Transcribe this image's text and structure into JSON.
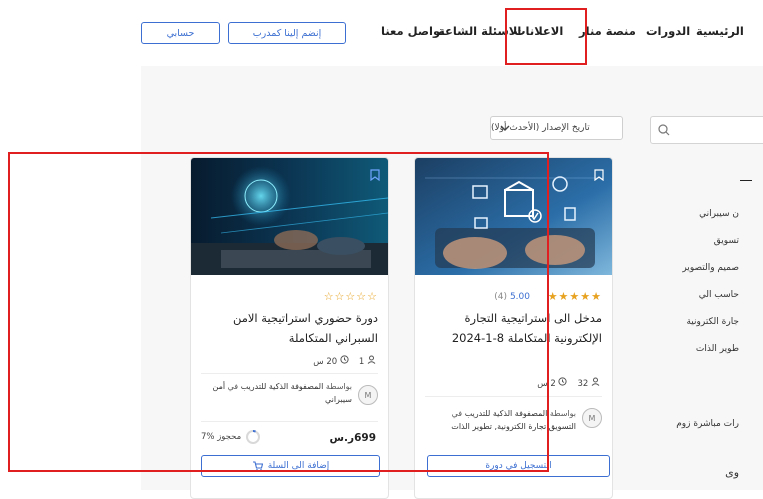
{
  "nav": {
    "items": [
      "الرئيسية",
      "الدورات",
      "منصة منار",
      "الاعلانات",
      "الاسئلة الشاعة",
      "تواصل معنا"
    ],
    "join_trainer_label": "إنضم إلينا كمدرب",
    "account_label": "حسابي"
  },
  "filters": {
    "sort_label": "تاريخ الإصدار (الأحدث أولا)",
    "search_placeholder": ""
  },
  "sidebar": {
    "categories": [
      "ن سيبراني",
      "تسويق",
      "صميم والتصوير",
      "حاسب الي",
      "جارة الكترونية",
      "طوير الذات",
      "رات مباشرة زوم"
    ],
    "section_label": "وى"
  },
  "courses": [
    {
      "title": "مدخل الى استراتيجية التجارة الإلكترونية المتكاملة 8-1-2024",
      "rating": "5.00",
      "rating_count": "(4)",
      "stars_filled": 5,
      "students": "32",
      "hours": "2 س",
      "provider_prefix": "بواسطة",
      "provider_name": "المصفوفة الذكية للتدريب",
      "provider_in": "في",
      "provider_category": "التسويق,تجارة الكترونية, تطوير الذات",
      "provider_logo": "M",
      "action_label": "التسجيل في دورة"
    },
    {
      "title": "دورة حضوري استراتيجية الامن السبراني المتكاملة",
      "rating": "",
      "rating_count": "",
      "stars_filled": 0,
      "students": "1",
      "hours": "20 س",
      "provider_prefix": "بواسطة",
      "provider_name": "المصفوفة الذكية للتدريب",
      "provider_in": "في",
      "provider_category": "أمن سيبراني",
      "provider_logo": "M",
      "price": "699ر.س",
      "booked": "7% محجوز",
      "booked_fraction": 0.07,
      "action_label": "إضافة الى السلة"
    }
  ],
  "colors": {
    "accent": "#3c6fd1",
    "star": "#e7a21f",
    "highlight": "#e02020"
  }
}
